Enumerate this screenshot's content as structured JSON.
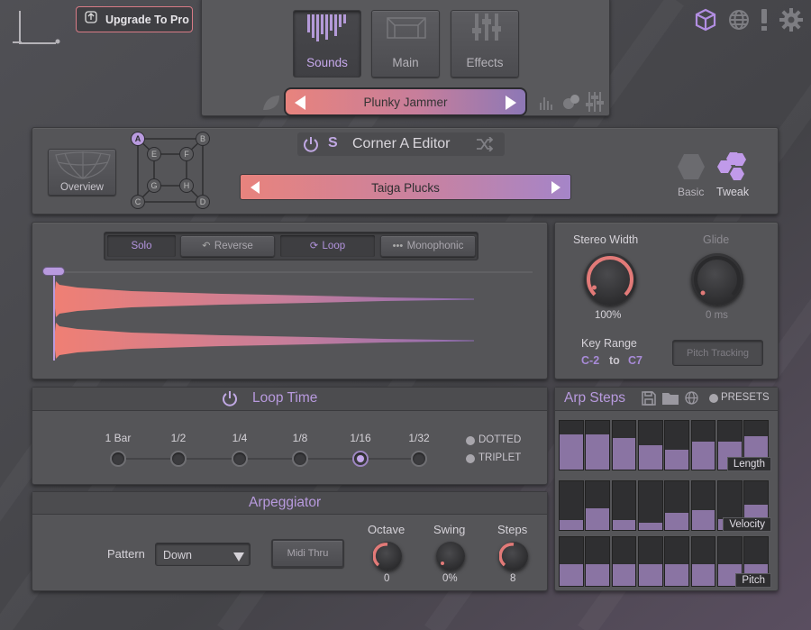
{
  "header": {
    "logo": "L.",
    "upgrade_label": "Upgrade To Pro",
    "tabs": [
      {
        "label": "Sounds",
        "active": true
      },
      {
        "label": "Main",
        "active": false
      },
      {
        "label": "Effects",
        "active": false
      }
    ],
    "preset_name": "Plunky Jammer",
    "icons": [
      "cube-icon",
      "globe-icon",
      "alert-icon",
      "gear-icon"
    ]
  },
  "corner_editor": {
    "overview_label": "Overview",
    "corners": [
      "A",
      "B",
      "C",
      "D"
    ],
    "nodes": [
      "E",
      "F",
      "G",
      "H"
    ],
    "power_icon": "power-icon",
    "solo_letter": "S",
    "title": "Corner A Editor",
    "sound_name": "Taiga Plucks",
    "mode_basic": "Basic",
    "mode_tweak": "Tweak"
  },
  "sample": {
    "buttons": [
      {
        "label": "Solo"
      },
      {
        "label": "Reverse"
      },
      {
        "label": "Loop"
      },
      {
        "label": "Monophonic"
      }
    ]
  },
  "voice": {
    "stereo_width_label": "Stereo Width",
    "stereo_width_value": "100%",
    "stereo_width_level": 1.0,
    "glide_label": "Glide",
    "glide_value": "0 ms",
    "glide_level": 0.0,
    "key_range_label": "Key Range",
    "key_low": "C-2",
    "key_to": "to",
    "key_high": "C7",
    "pitch_tracking_label": "Pitch Tracking"
  },
  "loop_time": {
    "title": "Loop Time",
    "options": [
      "1 Bar",
      "1/2",
      "1/4",
      "1/8",
      "1/16",
      "1/32"
    ],
    "selected_index": 4,
    "dotted_label": "DOTTED",
    "triplet_label": "TRIPLET"
  },
  "arp_steps": {
    "title": "Arp Steps",
    "presets_label": "PRESETS",
    "rows": [
      {
        "label": "Length",
        "values": [
          0.72,
          0.72,
          0.64,
          0.5,
          0.4,
          0.58,
          0.58,
          0.68
        ]
      },
      {
        "label": "Velocity",
        "values": [
          0.2,
          0.45,
          0.2,
          0.15,
          0.35,
          0.4,
          0.22,
          0.52
        ]
      },
      {
        "label": "Pitch",
        "values": [
          0.45,
          0.45,
          0.45,
          0.45,
          0.45,
          0.45,
          0.45,
          0.45
        ]
      }
    ]
  },
  "arpeggiator": {
    "title": "Arpeggiator",
    "pattern_label": "Pattern",
    "pattern_value": "Down",
    "midi_thru_label": "Midi Thru",
    "knobs": [
      {
        "label": "Octave",
        "value": "0",
        "level": 0.5
      },
      {
        "label": "Swing",
        "value": "0%",
        "level": 0.0
      },
      {
        "label": "Steps",
        "value": "8",
        "level": 0.5
      }
    ]
  },
  "colors": {
    "accent": "#b89ade",
    "salmon": "#e77f7a",
    "panel": "#555558"
  }
}
